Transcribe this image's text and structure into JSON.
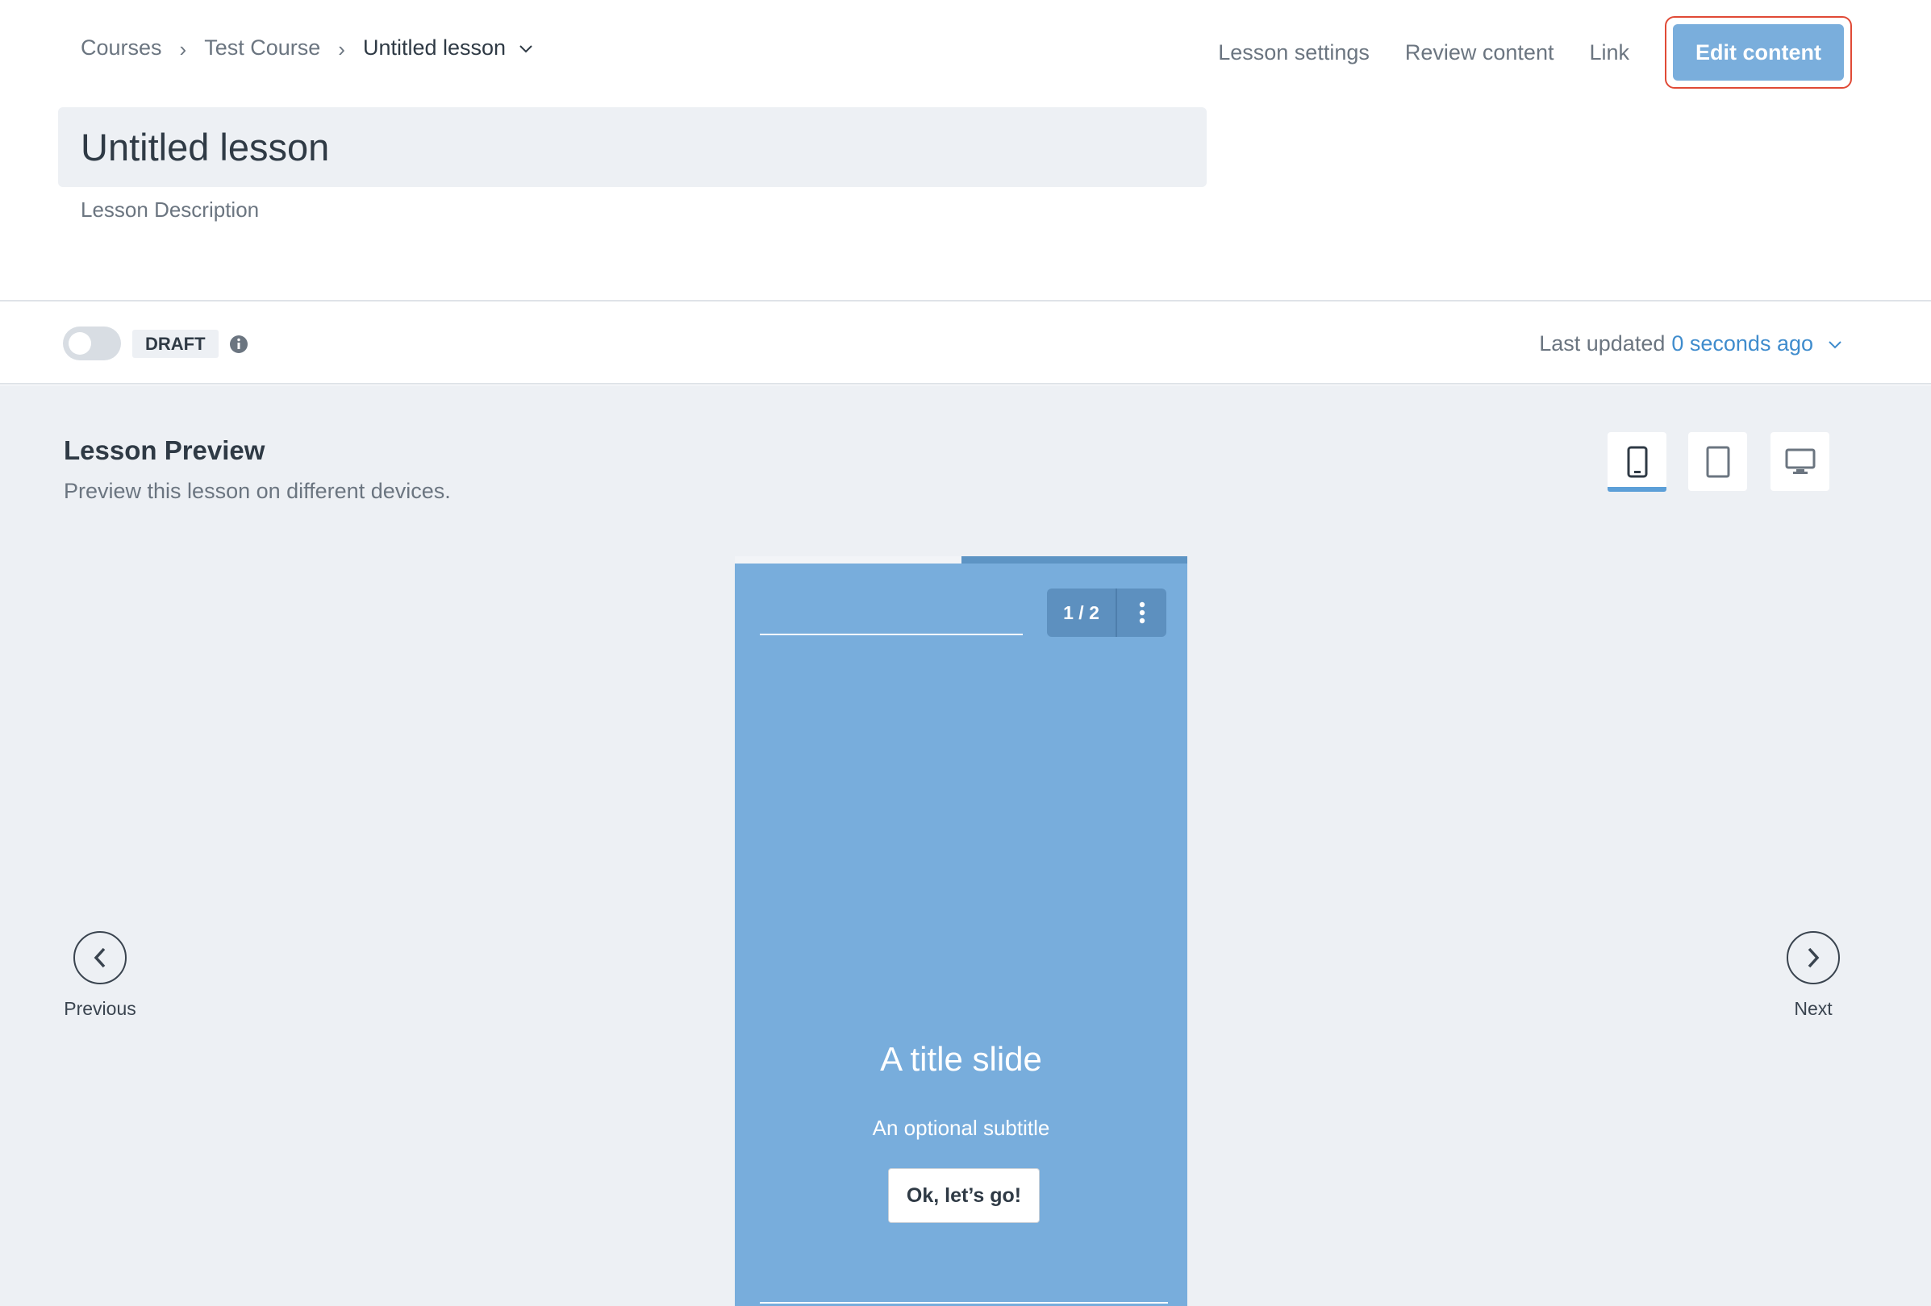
{
  "breadcrumb": {
    "courses": "Courses",
    "course": "Test Course",
    "lesson": "Untitled lesson"
  },
  "topnav": {
    "lesson_settings": "Lesson settings",
    "review_content": "Review content",
    "link": "Link",
    "edit_content": "Edit content"
  },
  "lesson": {
    "title": "Untitled lesson",
    "description_placeholder": "Lesson Description"
  },
  "status": {
    "badge": "DRAFT",
    "published": false,
    "last_updated_label": "Last updated",
    "last_updated_time": "0 seconds ago"
  },
  "preview": {
    "title": "Lesson Preview",
    "subtitle": "Preview this lesson on different devices.",
    "devices": [
      "phone-icon",
      "tablet-icon",
      "desktop-icon"
    ],
    "active_device": "phone",
    "progress_fraction": 0.5,
    "counter": "1 / 2",
    "slide_title": "A title slide",
    "slide_subtitle": "An optional subtitle",
    "slide_button": "Ok, let’s go!",
    "previous_label": "Previous",
    "next_label": "Next"
  },
  "colors": {
    "accent": "#7aaedc",
    "slide_bg": "#78addc",
    "link_blue": "#3f8ccd",
    "highlight_border": "#e04a36"
  }
}
